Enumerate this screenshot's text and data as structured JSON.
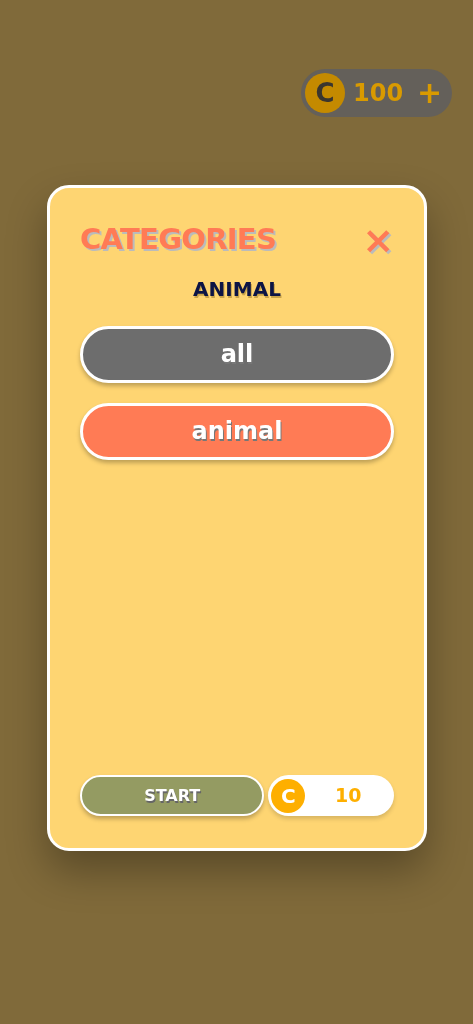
{
  "wallet": {
    "coin_symbol": "C",
    "balance": "100",
    "add_label": "+"
  },
  "dialog": {
    "title": "CATEGORIES",
    "close_label": "×",
    "subtitle": "ANIMAL",
    "categories": [
      {
        "label": "all",
        "selected": false
      },
      {
        "label": "animal",
        "selected": true
      }
    ],
    "start_label": "START",
    "cost": {
      "coin_symbol": "C",
      "amount": "10"
    }
  }
}
